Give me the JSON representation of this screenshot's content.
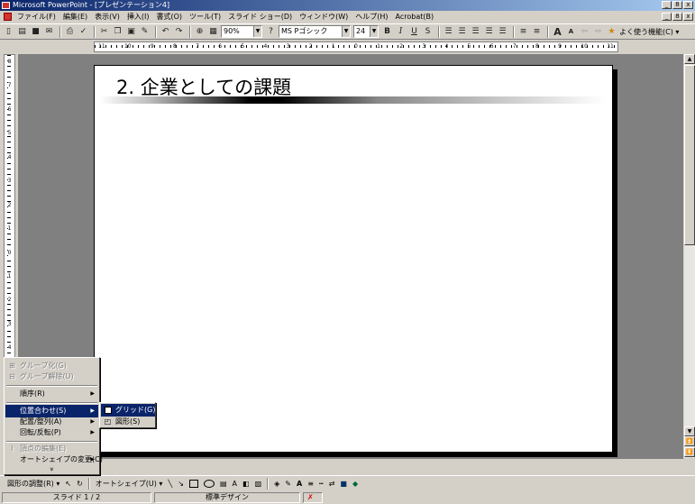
{
  "window": {
    "title": "Microsoft PowerPoint - [プレゼンテーション4]",
    "btn_min": "_",
    "btn_max": "8",
    "btn_close": "x"
  },
  "menubar": {
    "items": [
      "ファイル(F)",
      "編集(E)",
      "表示(V)",
      "挿入(I)",
      "書式(O)",
      "ツール(T)",
      "スライド ショー(D)",
      "ウィンドウ(W)",
      "ヘルプ(H)",
      "Acrobat(B)"
    ]
  },
  "toolbar": {
    "zoom": "90%",
    "font_name": "MS Pゴシック",
    "font_size": "24",
    "bold": "B",
    "italic": "I",
    "underline": "U",
    "shadow": "S",
    "grow_font": "A",
    "shrink_font": "A",
    "common_tasks": "よく使う機能(C) ▾"
  },
  "ruler": {
    "h_labels": [
      "11",
      "10",
      "9",
      "8",
      "7",
      "6",
      "5",
      "4",
      "3",
      "2",
      "1",
      "0",
      "1",
      "2",
      "3",
      "4",
      "5",
      "6",
      "7",
      "8",
      "9",
      "10",
      "11"
    ],
    "v_labels": [
      "8",
      "7",
      "6",
      "5",
      "4",
      "3",
      "2",
      "1",
      "0",
      "1",
      "2",
      "3",
      "4",
      "5",
      "6",
      "7",
      "8"
    ]
  },
  "slide": {
    "title": "2. 企業としての課題"
  },
  "draw_menu": {
    "items": [
      {
        "label": "グループ化(G)",
        "disabled": true
      },
      {
        "label": "グループ解除(U)",
        "disabled": true
      },
      {
        "label": "順序(R)",
        "disabled": false,
        "submenu": true
      },
      {
        "label": "位置合わせ(S)",
        "disabled": false,
        "submenu": true,
        "selected": true
      },
      {
        "label": "配置/整列(A)",
        "disabled": false,
        "submenu": true
      },
      {
        "label": "回転/反転(P)",
        "disabled": false,
        "submenu": true
      },
      {
        "label": "頂点の編集(E)",
        "disabled": true
      },
      {
        "label": "オートシェイプの変更(C)",
        "disabled": false,
        "submenu": true
      }
    ],
    "more": "»"
  },
  "snap_submenu": {
    "items": [
      {
        "label": "グリッド(G)",
        "selected": true
      },
      {
        "label": "図形(S)",
        "selected": false
      }
    ]
  },
  "drawbar": {
    "draw": "図形の調整(R) ▾",
    "autoshape": "オートシェイプ(U) ▾"
  },
  "status": {
    "slide": "スライド 1 / 2",
    "design": "標準デザイン"
  }
}
